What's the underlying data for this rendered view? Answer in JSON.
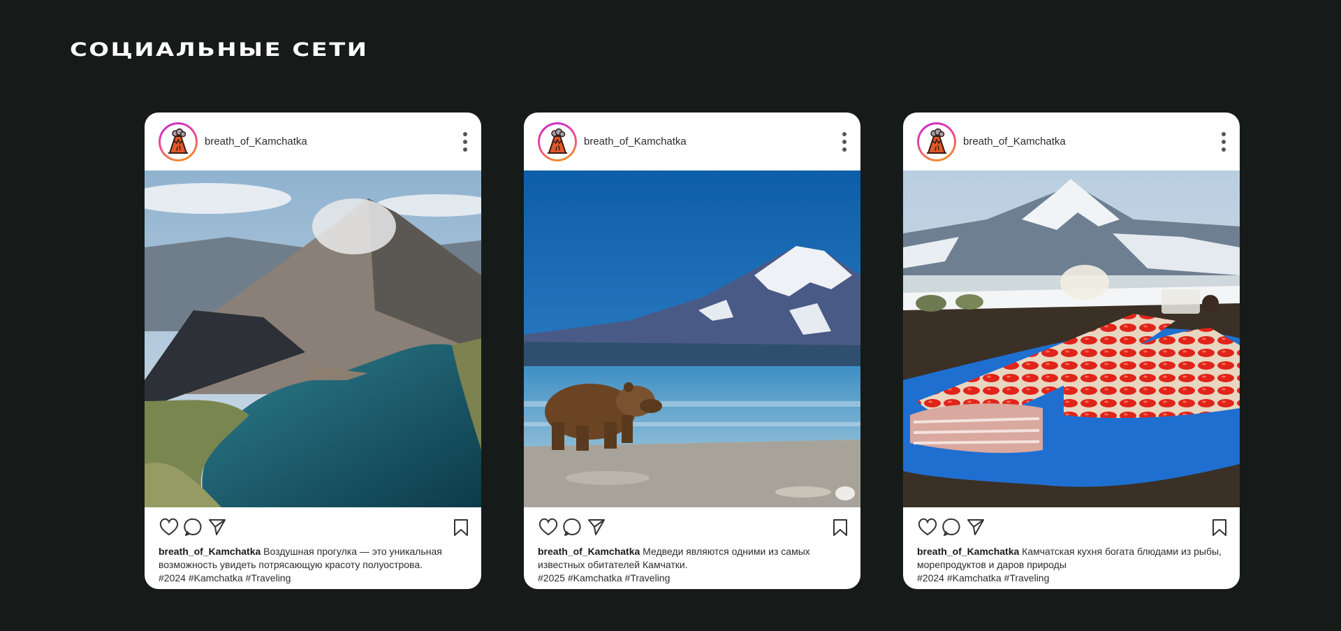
{
  "page": {
    "title": "СОЦИАЛЬНЫЕ СЕТИ"
  },
  "posts": [
    {
      "username": "breath_of_Kamchatka",
      "caption_user": "breath_of_Kamchatka",
      "caption_text": "Воздушная прогулка — это уникальная возможность увидеть потрясающую красоту полуострова.",
      "hashtags": "#2024 #Kamchatka #Traveling"
    },
    {
      "username": "breath_of_Kamchatka",
      "caption_user": "breath_of_Kamchatka",
      "caption_text": "Медведи являются одними из самых известных обитателей Камчатки.",
      "hashtags": "#2025 #Kamchatka #Traveling"
    },
    {
      "username": "breath_of_Kamchatka",
      "caption_user": "breath_of_Kamchatka",
      "caption_text": "Камчатская кухня богата блюдами из рыбы, морепродуктов и даров природы",
      "hashtags": "#2024 #Kamchatka #Traveling"
    }
  ],
  "icons": {
    "avatar": "volcano-icon",
    "menu": "more-vertical-icon",
    "like": "heart-icon",
    "comment": "comment-icon",
    "share": "send-icon",
    "save": "bookmark-icon"
  },
  "colors": {
    "background": "#161a19",
    "card": "#ffffff",
    "avatar_ring_start": "#c026d3",
    "avatar_ring_end": "#f59e0b",
    "volcano": "#e0592a"
  }
}
